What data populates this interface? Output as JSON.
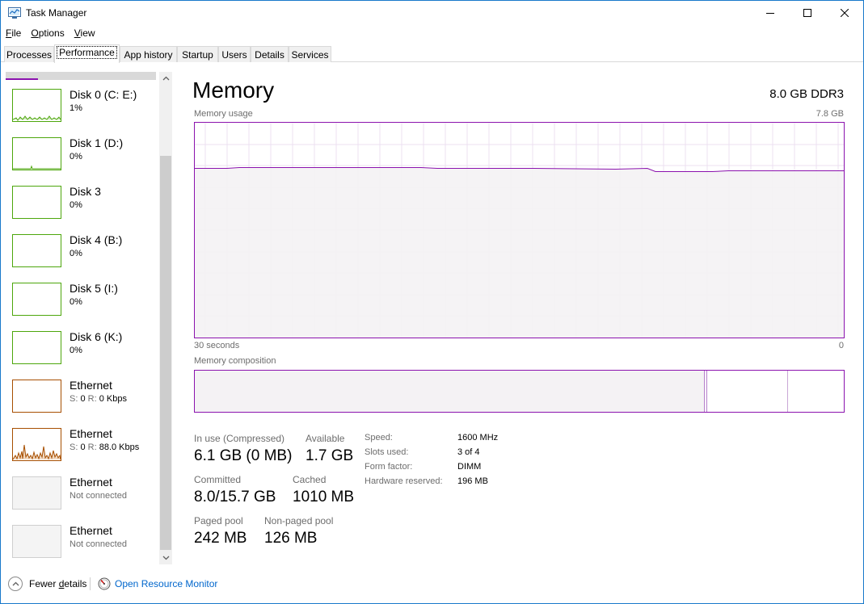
{
  "window": {
    "title": "Task Manager"
  },
  "menu": [
    {
      "accel": "F",
      "rest": "ile"
    },
    {
      "accel": "O",
      "rest": "ptions"
    },
    {
      "accel": "V",
      "rest": "iew"
    }
  ],
  "tabs": [
    "Processes",
    "Performance",
    "App history",
    "Startup",
    "Users",
    "Details",
    "Services"
  ],
  "active_tab": "Performance",
  "sidebar": {
    "items": [
      {
        "name": "Disk 0 (C: E:)",
        "sub": "1%",
        "kind": "disk"
      },
      {
        "name": "Disk 1 (D:)",
        "sub": "0%",
        "kind": "disk"
      },
      {
        "name": "Disk 3",
        "sub": "0%",
        "kind": "disk"
      },
      {
        "name": "Disk 4 (B:)",
        "sub": "0%",
        "kind": "disk"
      },
      {
        "name": "Disk 5 (I:)",
        "sub": "0%",
        "kind": "disk"
      },
      {
        "name": "Disk 6 (K:)",
        "sub": "0%",
        "kind": "disk"
      },
      {
        "name": "Ethernet",
        "s_label": "S:",
        "s_val": "0",
        "r_label": "R:",
        "r_val": "0 Kbps",
        "kind": "ethernet"
      },
      {
        "name": "Ethernet",
        "s_label": "S:",
        "s_val": "0",
        "r_label": "R:",
        "r_val": "88.0 Kbps",
        "kind": "ethernet"
      },
      {
        "name": "Ethernet",
        "sub": "Not connected",
        "kind": "offline"
      },
      {
        "name": "Ethernet",
        "sub": "Not connected",
        "kind": "offline"
      }
    ]
  },
  "memory": {
    "title": "Memory",
    "spec": "8.0 GB DDR3",
    "usage_label": "Memory usage",
    "usage_max": "7.8 GB",
    "time_left": "30 seconds",
    "time_right": "0",
    "composition_label": "Memory composition",
    "usage_fraction": 0.78,
    "stats": {
      "in_use_label": "In use (Compressed)",
      "in_use_value": "6.1 GB (0 MB)",
      "available_label": "Available",
      "available_value": "1.7 GB",
      "committed_label": "Committed",
      "committed_value": "8.0/15.7 GB",
      "cached_label": "Cached",
      "cached_value": "1010 MB",
      "paged_label": "Paged pool",
      "paged_value": "242 MB",
      "nonpaged_label": "Non-paged pool",
      "nonpaged_value": "126 MB"
    },
    "details": {
      "speed_label": "Speed:",
      "speed_value": "1600 MHz",
      "slots_label": "Slots used:",
      "slots_value": "3 of 4",
      "form_label": "Form factor:",
      "form_value": "DIMM",
      "reserved_label": "Hardware reserved:",
      "reserved_value": "196 MB"
    }
  },
  "footer": {
    "fewer_accel": "d",
    "fewer_pre": "Fewer ",
    "fewer_post": "etails",
    "resource_monitor": "Open Resource Monitor"
  },
  "colors": {
    "memory_accent": "#8b12ae",
    "disk_accent": "#4da60c",
    "ethernet_accent": "#a74f01"
  }
}
